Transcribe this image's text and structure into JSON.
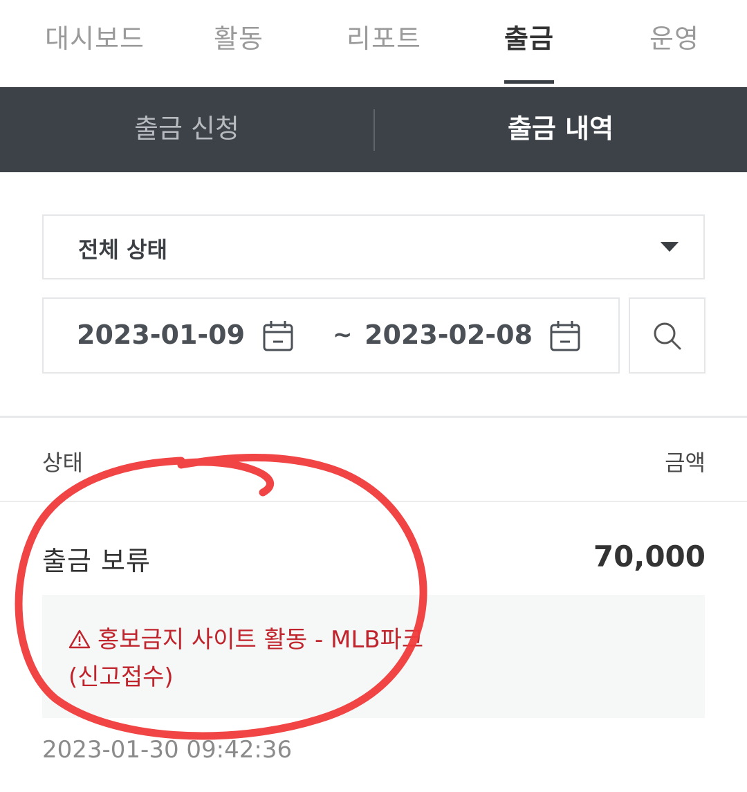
{
  "top_tabs": {
    "items": [
      {
        "label": "대시보드"
      },
      {
        "label": "활동"
      },
      {
        "label": "리포트"
      },
      {
        "label": "출금"
      },
      {
        "label": "운영"
      }
    ],
    "active": "출금"
  },
  "sub_tabs": {
    "request": "출금 신청",
    "history": "출금 내역",
    "active": "출금 내역"
  },
  "filter": {
    "status_selected": "전체 상태",
    "start_date": "2023-01-09",
    "separator": "~",
    "end_date": "2023-02-08"
  },
  "table": {
    "header_status": "상태",
    "header_amount": "금액",
    "rows": [
      {
        "status": "출금 보류",
        "amount": "70,000",
        "notice_line1": "홍보금지 사이트 활동 - MLB파크",
        "notice_line2": "(신고접수)",
        "datetime": "2023-01-30 09:42:36"
      }
    ]
  },
  "colors": {
    "header_bar": "#3c4248",
    "notice_text": "#c0242c",
    "annotation": "#f03a3a"
  },
  "icons": {
    "date_start": "calendar-icon",
    "date_end": "calendar-icon",
    "search": "search-icon",
    "warning": "warning-icon",
    "dropdown": "caret-down-icon"
  }
}
